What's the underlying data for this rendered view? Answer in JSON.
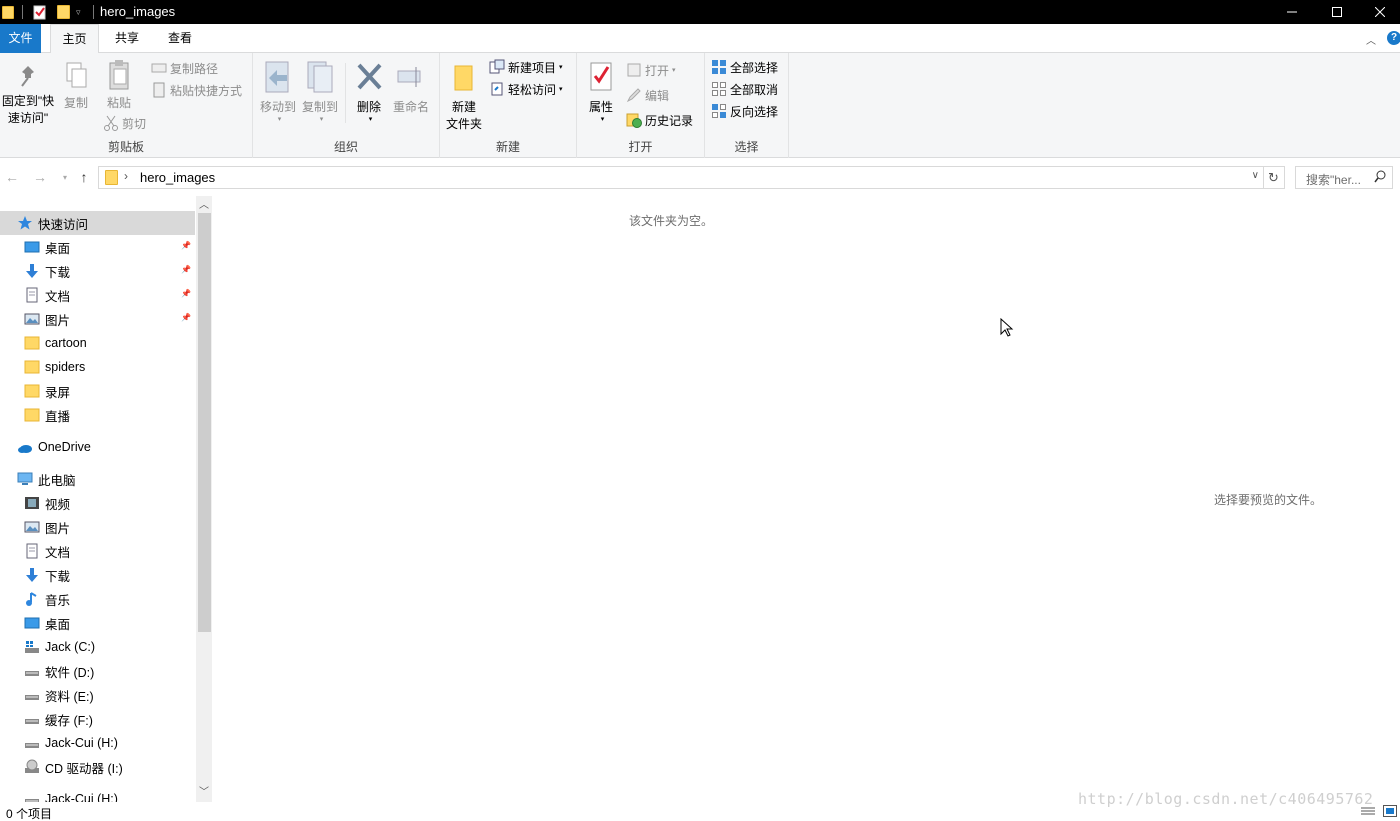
{
  "window": {
    "title": "hero_images",
    "controls": {
      "minimize": "minimize",
      "maximize": "maximize",
      "close": "close"
    }
  },
  "tabs": [
    {
      "label": "文件"
    },
    {
      "label": "主页"
    },
    {
      "label": "共享"
    },
    {
      "label": "查看"
    }
  ],
  "ribbon": {
    "clipboard": {
      "label": "剪贴板",
      "pin_line1": "固定到\"快",
      "pin_line2": "速访问\"",
      "copy": "复制",
      "paste": "粘贴",
      "copy_path": "复制路径",
      "paste_shortcut": "粘贴快捷方式",
      "cut": "剪切"
    },
    "organize": {
      "label": "组织",
      "move_to": "移动到",
      "copy_to": "复制到",
      "delete": "删除",
      "rename": "重命名"
    },
    "new": {
      "label": "新建",
      "new_folder_line1": "新建",
      "new_folder_line2": "文件夹",
      "new_item": "新建项目",
      "easy_access": "轻松访问"
    },
    "open": {
      "label": "打开",
      "properties": "属性",
      "open": "打开",
      "edit": "编辑",
      "history": "历史记录"
    },
    "select": {
      "label": "选择",
      "select_all": "全部选择",
      "select_none": "全部取消",
      "invert": "反向选择"
    }
  },
  "address": {
    "path": "hero_images",
    "search_placeholder": "搜索\"her..."
  },
  "nav": {
    "quick_access": "快速访问",
    "quick_items": [
      {
        "label": "桌面",
        "pinned": true
      },
      {
        "label": "下载",
        "pinned": true
      },
      {
        "label": "文档",
        "pinned": true
      },
      {
        "label": "图片",
        "pinned": true
      },
      {
        "label": "cartoon"
      },
      {
        "label": "spiders"
      },
      {
        "label": "录屏"
      },
      {
        "label": "直播"
      }
    ],
    "onedrive": "OneDrive",
    "this_pc": "此电脑",
    "pc_items": [
      {
        "label": "视频"
      },
      {
        "label": "图片"
      },
      {
        "label": "文档"
      },
      {
        "label": "下载"
      },
      {
        "label": "音乐"
      },
      {
        "label": "桌面"
      },
      {
        "label": "Jack (C:)"
      },
      {
        "label": "软件 (D:)"
      },
      {
        "label": "资料 (E:)"
      },
      {
        "label": "缓存 (F:)"
      },
      {
        "label": "Jack-Cui (H:)"
      },
      {
        "label": "CD 驱动器 (I:)"
      },
      {
        "label": "Jack-Cui (H:)"
      }
    ]
  },
  "content": {
    "empty_message": "该文件夹为空。",
    "preview_message": "选择要预览的文件。"
  },
  "status": {
    "item_count": "0 个项目"
  },
  "watermark": "http://blog.csdn.net/c406495762"
}
